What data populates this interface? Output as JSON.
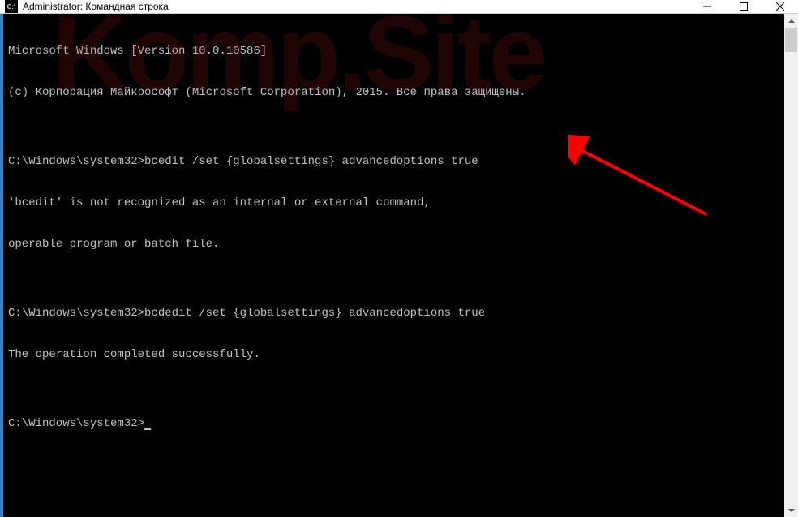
{
  "window": {
    "icon_label": "C:\\",
    "title": "Administrator: Командная строка"
  },
  "terminal": {
    "lines": [
      "Microsoft Windows [Version 10.0.10586]",
      "(c) Корпорация Майкрософт (Microsoft Corporation), 2015. Все права защищены.",
      "",
      "C:\\Windows\\system32>bcedit /set {globalsettings} advancedoptions true",
      "'bcedit' is not recognized as an internal or external command,",
      "operable program or batch file.",
      "",
      "C:\\Windows\\system32>bcdedit /set {globalsettings} advancedoptions true",
      "The operation completed successfully.",
      "",
      "C:\\Windows\\system32>"
    ]
  },
  "watermark": {
    "text": "Komp.Site"
  },
  "colors": {
    "terminal_bg": "#000000",
    "terminal_fg": "#c0c0c0",
    "titlebar_bg": "#ffffff",
    "arrow": "#ff0000"
  }
}
